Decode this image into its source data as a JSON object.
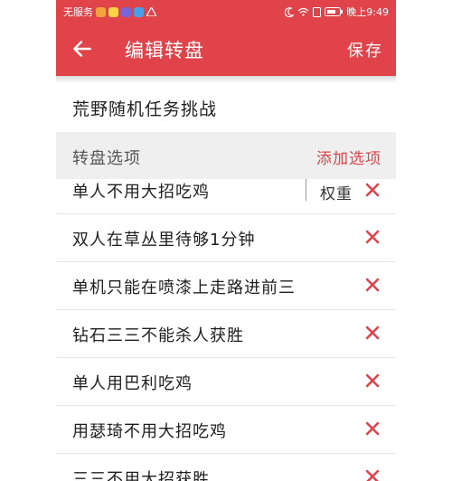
{
  "status_bar": {
    "left_text": "无服务",
    "time": "晚上9:49"
  },
  "app_bar": {
    "title": "编辑转盘",
    "save_label": "保存"
  },
  "wheel": {
    "name": "荒野随机任务挑战"
  },
  "options_header": {
    "label": "转盘选项",
    "add_label": "添加选项"
  },
  "options": [
    {
      "text": "单人不用大招吃鸡",
      "weight_label": "权重"
    },
    {
      "text": "双人在草丛里待够1分钟"
    },
    {
      "text": "单机只能在喷漆上走路进前三"
    },
    {
      "text": "钻石三三不能杀人获胜"
    },
    {
      "text": "单人用巴利吃鸡"
    },
    {
      "text": "用瑟琦不用大招吃鸡"
    },
    {
      "text": "三三不用大招获胜"
    }
  ],
  "colors": {
    "accent": "#e1434a",
    "header_bg": "#efefef"
  }
}
